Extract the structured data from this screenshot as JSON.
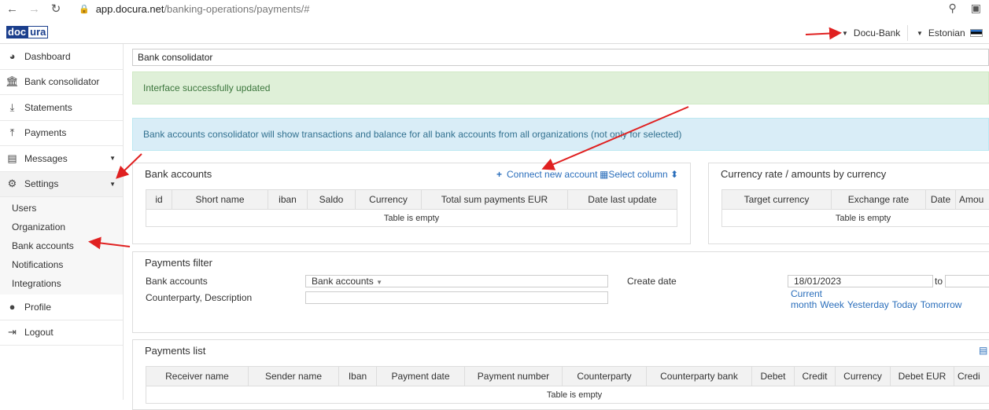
{
  "browser": {
    "url_host": "app.docura.net",
    "url_path": "/banking-operations/payments/#"
  },
  "app": {
    "logo_a": "doc",
    "logo_b": "ura",
    "org_menu": "Docu-Bank",
    "lang_menu": "Estonian"
  },
  "sidebar": {
    "items": [
      {
        "label": "Dashboard",
        "icon": "dashboard-icon"
      },
      {
        "label": "Bank consolidator",
        "icon": "bank-icon"
      },
      {
        "label": "Statements",
        "icon": "download-icon"
      },
      {
        "label": "Payments",
        "icon": "upload-icon"
      },
      {
        "label": "Messages",
        "icon": "message-icon"
      },
      {
        "label": "Settings",
        "icon": "gear-icon"
      }
    ],
    "settings_sub": [
      "Users",
      "Organization",
      "Bank accounts",
      "Notifications",
      "Integrations"
    ],
    "bottom": [
      {
        "label": "Profile",
        "icon": "user-icon"
      },
      {
        "label": "Logout",
        "icon": "logout-icon"
      }
    ]
  },
  "main": {
    "breadcrumb": "Bank consolidator",
    "alert_success": "Interface successfully updated",
    "alert_info": "Bank accounts consolidator will show transactions and balance for all bank accounts from all organizations (not only for selected)"
  },
  "bank_accounts": {
    "title": "Bank accounts",
    "connect": "Connect new account",
    "select_column": "Select column",
    "columns": [
      "id",
      "Short name",
      "iban",
      "Saldo",
      "Currency",
      "Total sum payments EUR",
      "Date last update"
    ],
    "empty": "Table is empty"
  },
  "currency": {
    "title": "Currency rate / amounts by currency",
    "columns": [
      "Target currency",
      "Exchange rate",
      "Date",
      "Amou"
    ],
    "empty": "Table is empty"
  },
  "filter": {
    "title": "Payments filter",
    "bank_accounts_label": "Bank accounts",
    "bank_accounts_value": "Bank accounts",
    "counterparty_label": "Counterparty, Description",
    "create_date_label": "Create date",
    "date_from": "18/01/2023",
    "to_label": "to",
    "quick": [
      "Current month",
      "Week",
      "Yesterday",
      "Today",
      "Tomorrow"
    ]
  },
  "payments_list": {
    "title": "Payments list",
    "columns": [
      "Receiver name",
      "Sender name",
      "Iban",
      "Payment date",
      "Payment number",
      "Counterparty",
      "Counterparty bank",
      "Debet",
      "Credit",
      "Currency",
      "Debet EUR",
      "Credi"
    ],
    "empty": "Table is empty"
  },
  "colors": {
    "annotation_arrow": "#e02020",
    "link": "#2a6ebb",
    "success_bg": "#dff0d8",
    "info_bg": "#d9edf7"
  }
}
